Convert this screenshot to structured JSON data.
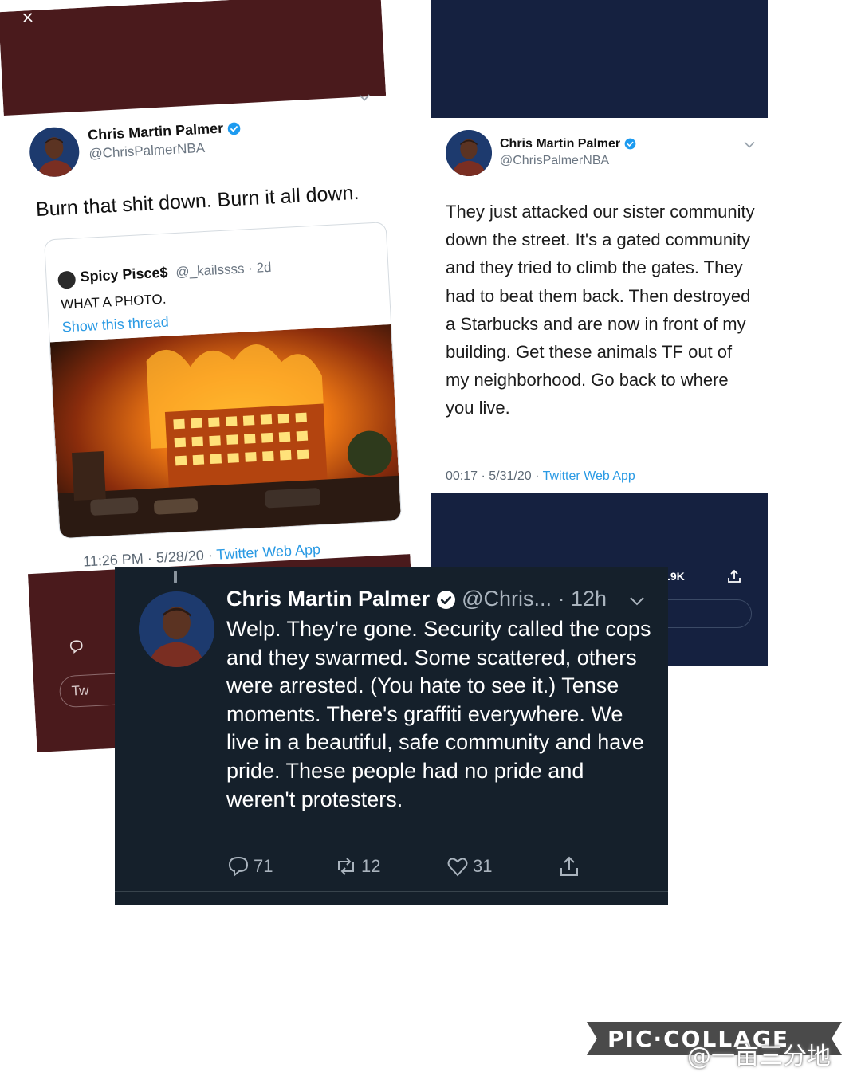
{
  "left_tweet": {
    "close_glyph": "×",
    "author_name": "Chris Martin Palmer",
    "author_handle": "@ChrisPalmerNBA",
    "text": "Burn that shit down. Burn it all down.",
    "quoted": {
      "author_name": "Spicy Pisce$",
      "author_handle": "@_kailssss · 2d",
      "text": "WHAT A PHOTO.",
      "link": "Show this thread"
    },
    "timestamp": "11:26 PM · 5/28/20 · ",
    "source": "Twitter Web App",
    "pill_fragment": "Tw"
  },
  "right_tweet": {
    "author_name": "Chris Martin Palmer",
    "author_handle": "@ChrisPalmerNBA",
    "text": "They just attacked our sister community down the street. It's a gated community and they tried to climb the gates. They had to beat them back. Then destroyed a Starbucks and are now in front of my building. Get these animals TF out of my neighborhood. Go back to where you live.",
    "timestamp": "00:17 · 5/31/20 · ",
    "source": "Twitter Web App",
    "count_fragment": ".9K"
  },
  "dark_tweet": {
    "author_name": "Chris Martin Palmer",
    "author_handle": "@Chris...",
    "time": " · 12h",
    "text": "Welp. They're gone. Security called the cops and they swarmed. Some scattered, others were arrested. (You hate to see it.) Tense moments. There's graffiti everywhere. We live in a beautiful, safe community and have pride. These people had no pride and weren't protesters.",
    "replies": "71",
    "retweets": "12",
    "likes": "31"
  },
  "watermark": {
    "brand": "PIC·COLLAGE",
    "credit": "@一亩三分地"
  },
  "colors": {
    "maroon_band": "#4a1a1c",
    "navy_band": "#152140",
    "dark_bg": "#15202b",
    "link_blue": "#2a9ae4",
    "verified_blue": "#1d9bf0"
  }
}
